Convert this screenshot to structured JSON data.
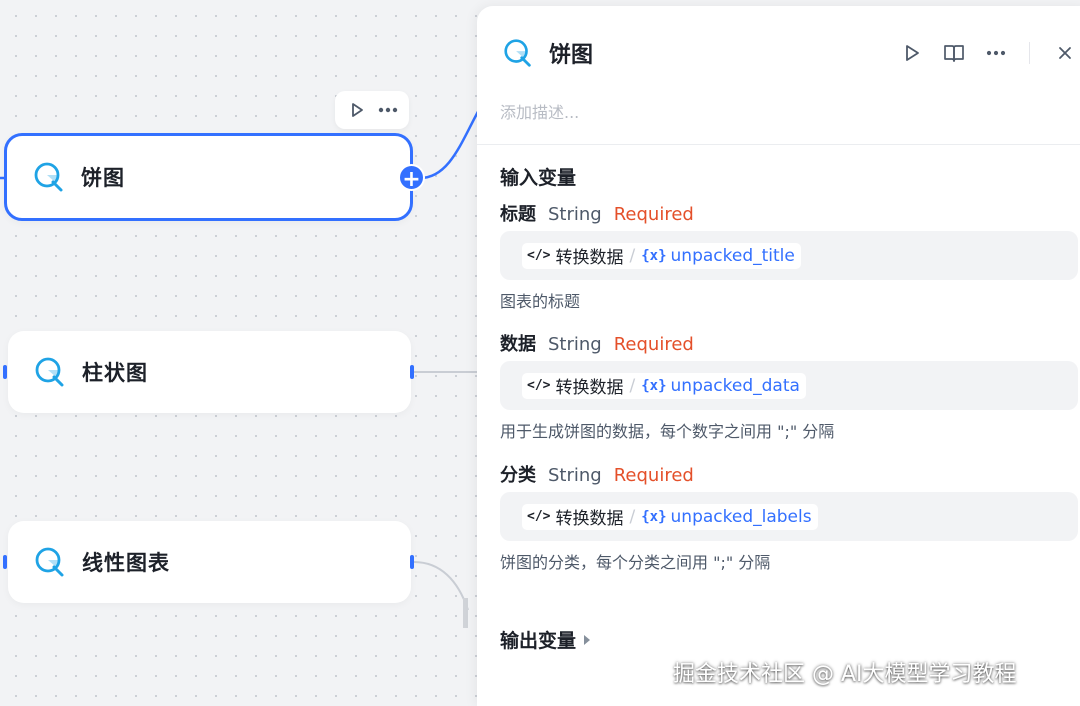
{
  "nodes": [
    {
      "title": "饼图",
      "icon": "chart-search-icon"
    },
    {
      "title": "柱状图",
      "icon": "chart-search-icon"
    },
    {
      "title": "线性图表",
      "icon": "chart-search-icon"
    }
  ],
  "node_toolbar": {
    "run_icon": "play-icon",
    "more_icon": "more-dots-icon"
  },
  "panel": {
    "title": "饼图",
    "description_placeholder": "添加描述...",
    "header_icons": [
      "play-icon",
      "book-icon",
      "more-dots-icon",
      "close-icon"
    ],
    "input_section_title": "输入变量",
    "output_section_title": "输出变量",
    "inputs": [
      {
        "name": "标题",
        "type": "String",
        "required": "Required",
        "source": "转换数据",
        "separator": "/",
        "var_prefix": "{x}",
        "var": "unpacked_title",
        "description": "图表的标题"
      },
      {
        "name": "数据",
        "type": "String",
        "required": "Required",
        "source": "转换数据",
        "separator": "/",
        "var_prefix": "{x}",
        "var": "unpacked_data",
        "description": "用于生成饼图的数据，每个数字之间用 \";\" 分隔"
      },
      {
        "name": "分类",
        "type": "String",
        "required": "Required",
        "source": "转换数据",
        "separator": "/",
        "var_prefix": "{x}",
        "var": "unpacked_labels",
        "description": "饼图的分类，每个分类之间用 \";\" 分隔"
      }
    ]
  },
  "colors": {
    "accent": "#3370ff",
    "required": "#e4502a",
    "icon": "#1fa3e5"
  },
  "watermark": "掘金技术社区 @ AI大模型学习教程"
}
